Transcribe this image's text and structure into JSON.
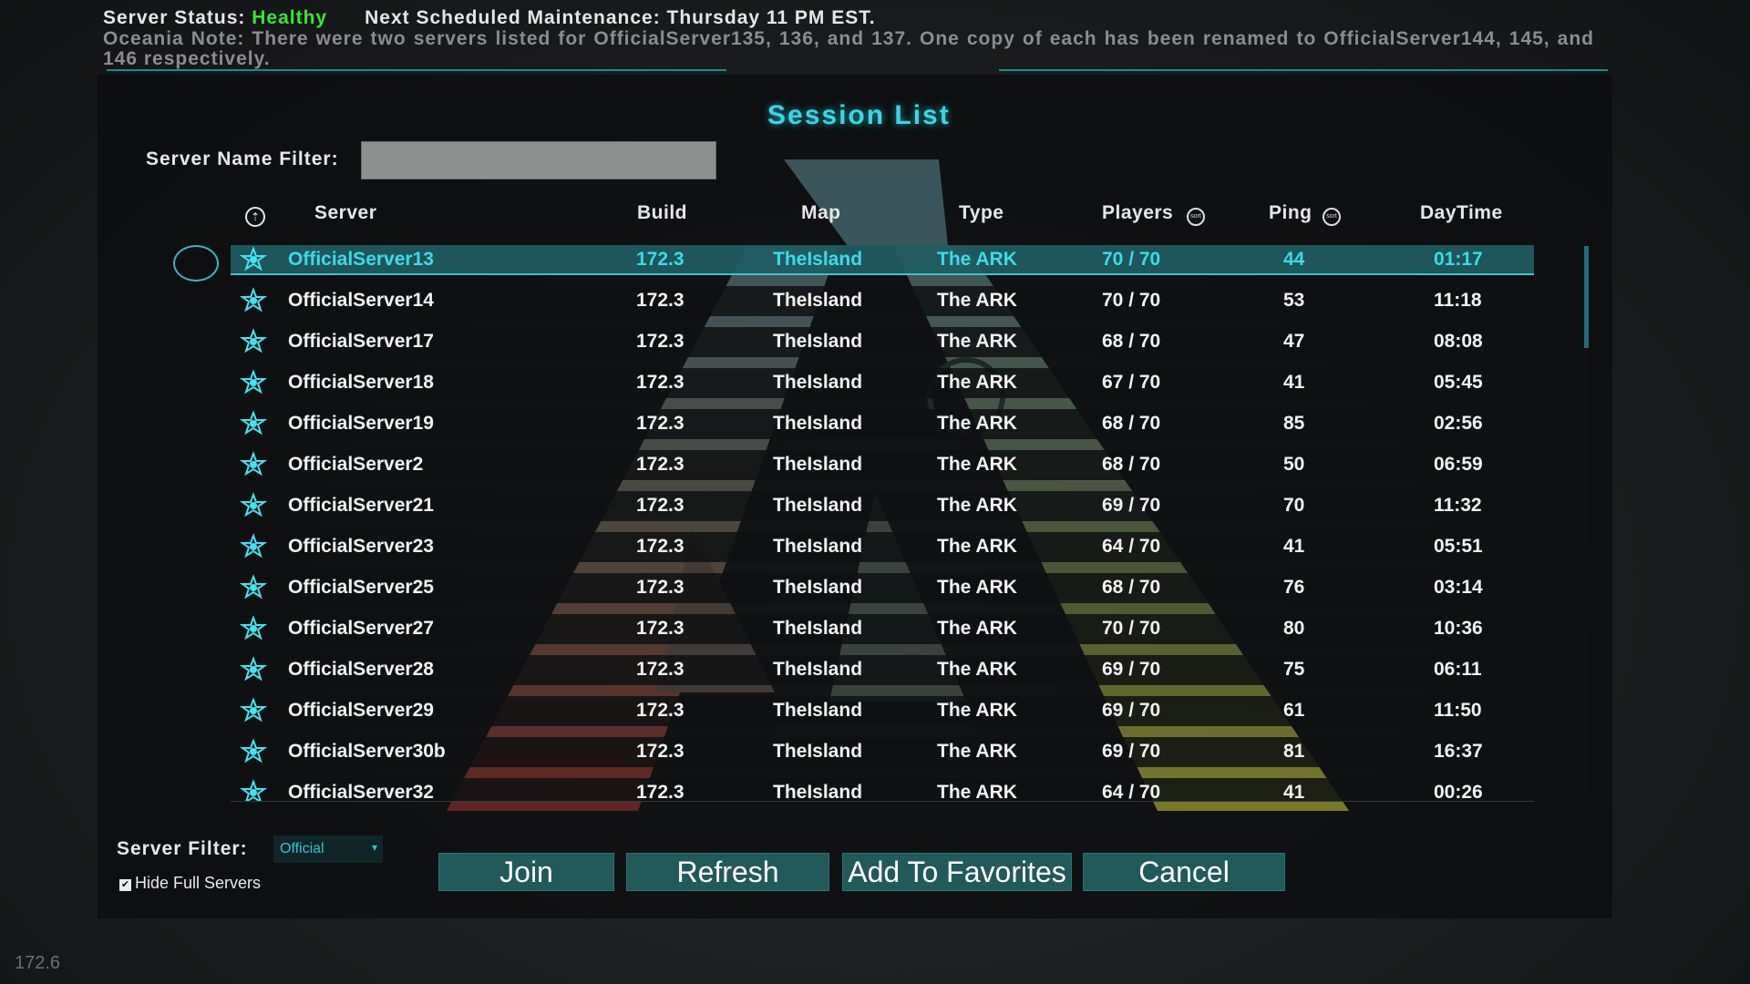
{
  "status": {
    "label": "Server  Status:",
    "value": "Healthy",
    "maintenance": "Next  Scheduled  Maintenance:  Thursday  11  PM  EST.",
    "note": "Oceania  Note:  There  were  two  servers  listed  for  OfficialServer135,  136,  and  137.  One  copy  of  each  has  been  renamed  to  OfficialServer144,  145,  and  146  respectively.",
    "value_color": "#38e62c"
  },
  "title": "Session  List",
  "name_filter": {
    "label": "Server  Name  Filter:",
    "value": ""
  },
  "columns": {
    "server": "Server",
    "build": "Build",
    "map": "Map",
    "type": "Type",
    "players": "Players",
    "ping": "Ping",
    "daytime": "DayTime",
    "sort_icon": "sort"
  },
  "rows": [
    {
      "server": "OfficialServer13",
      "build": "172.3",
      "map": "TheIsland",
      "type": "The ARK",
      "players": "70 / 70",
      "ping": "44",
      "daytime": "01:17",
      "selected": true
    },
    {
      "server": "OfficialServer14",
      "build": "172.3",
      "map": "TheIsland",
      "type": "The ARK",
      "players": "70 / 70",
      "ping": "53",
      "daytime": "11:18"
    },
    {
      "server": "OfficialServer17",
      "build": "172.3",
      "map": "TheIsland",
      "type": "The ARK",
      "players": "68 / 70",
      "ping": "47",
      "daytime": "08:08"
    },
    {
      "server": "OfficialServer18",
      "build": "172.3",
      "map": "TheIsland",
      "type": "The ARK",
      "players": "67 / 70",
      "ping": "41",
      "daytime": "05:45"
    },
    {
      "server": "OfficialServer19",
      "build": "172.3",
      "map": "TheIsland",
      "type": "The ARK",
      "players": "68 / 70",
      "ping": "85",
      "daytime": "02:56"
    },
    {
      "server": "OfficialServer2",
      "build": "172.3",
      "map": "TheIsland",
      "type": "The ARK",
      "players": "68 / 70",
      "ping": "50",
      "daytime": "06:59"
    },
    {
      "server": "OfficialServer21",
      "build": "172.3",
      "map": "TheIsland",
      "type": "The ARK",
      "players": "69 / 70",
      "ping": "70",
      "daytime": "11:32"
    },
    {
      "server": "OfficialServer23",
      "build": "172.3",
      "map": "TheIsland",
      "type": "The ARK",
      "players": "64 / 70",
      "ping": "41",
      "daytime": "05:51"
    },
    {
      "server": "OfficialServer25",
      "build": "172.3",
      "map": "TheIsland",
      "type": "The ARK",
      "players": "68 / 70",
      "ping": "76",
      "daytime": "03:14"
    },
    {
      "server": "OfficialServer27",
      "build": "172.3",
      "map": "TheIsland",
      "type": "The ARK",
      "players": "70 / 70",
      "ping": "80",
      "daytime": "10:36"
    },
    {
      "server": "OfficialServer28",
      "build": "172.3",
      "map": "TheIsland",
      "type": "The ARK",
      "players": "69 / 70",
      "ping": "75",
      "daytime": "06:11"
    },
    {
      "server": "OfficialServer29",
      "build": "172.3",
      "map": "TheIsland",
      "type": "The ARK",
      "players": "69 / 70",
      "ping": "61",
      "daytime": "11:50"
    },
    {
      "server": "OfficialServer30b",
      "build": "172.3",
      "map": "TheIsland",
      "type": "The ARK",
      "players": "69 / 70",
      "ping": "81",
      "daytime": "16:37"
    },
    {
      "server": "OfficialServer32",
      "build": "172.3",
      "map": "TheIsland",
      "type": "The ARK",
      "players": "64 / 70",
      "ping": "41",
      "daytime": "00:26"
    }
  ],
  "server_filter": {
    "label": "Server  Filter:",
    "selected": "Official"
  },
  "hide_full": {
    "label": "Hide Full Servers",
    "checked": true
  },
  "buttons": {
    "join": "Join",
    "refresh": "Refresh",
    "favorites": "Add To Favorites",
    "cancel": "Cancel"
  },
  "version": "172.6",
  "colors": {
    "accent": "#39d6e2",
    "selected_row": "#205c62",
    "button": "#22595b"
  }
}
